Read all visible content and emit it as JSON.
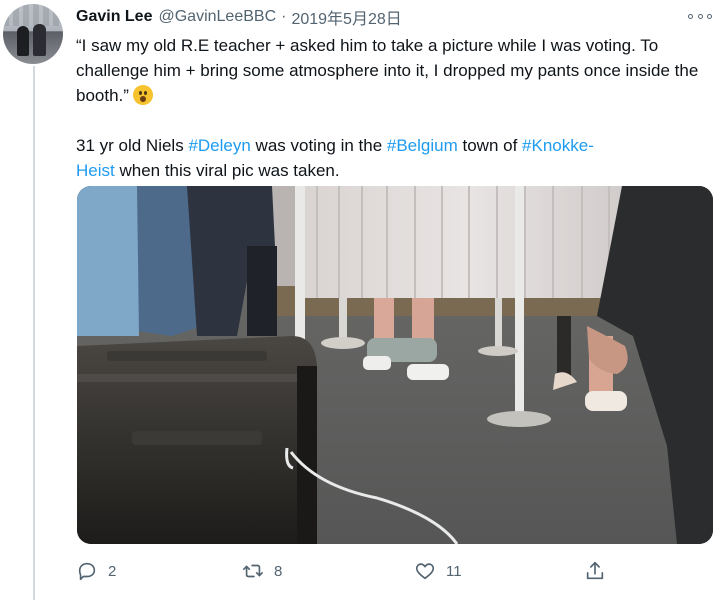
{
  "tweet": {
    "author_name": "Gavin Lee",
    "author_handle": "@GavinLeeBBC",
    "separator": "·",
    "date": "2019年5月28日",
    "quote": "“I saw my old R.E teacher + asked him to take a picture while I was voting. To challenge him + bring some atmosphere into it, I dropped my pants once inside the booth.”",
    "emoji_icon": "hushed-face-emoji",
    "body": {
      "part1": "31 yr old Niels ",
      "tag1": "#Deleyn",
      "part2": " was voting in the ",
      "tag2": "#Belgium",
      "part3": " town of ",
      "tag3": "#Knokke-",
      "tag3b": "Heist",
      "part4": " when this viral pic was taken."
    }
  },
  "actions": {
    "reply_count": "2",
    "retweet_count": "8",
    "like_count": "11",
    "reply_icon": "reply-icon",
    "retweet_icon": "retweet-icon",
    "like_icon": "heart-icon",
    "share_icon": "share-icon"
  },
  "colors": {
    "link": "#1d9bf0",
    "secondary_text": "#536471",
    "thread_line": "#cfd9de"
  }
}
